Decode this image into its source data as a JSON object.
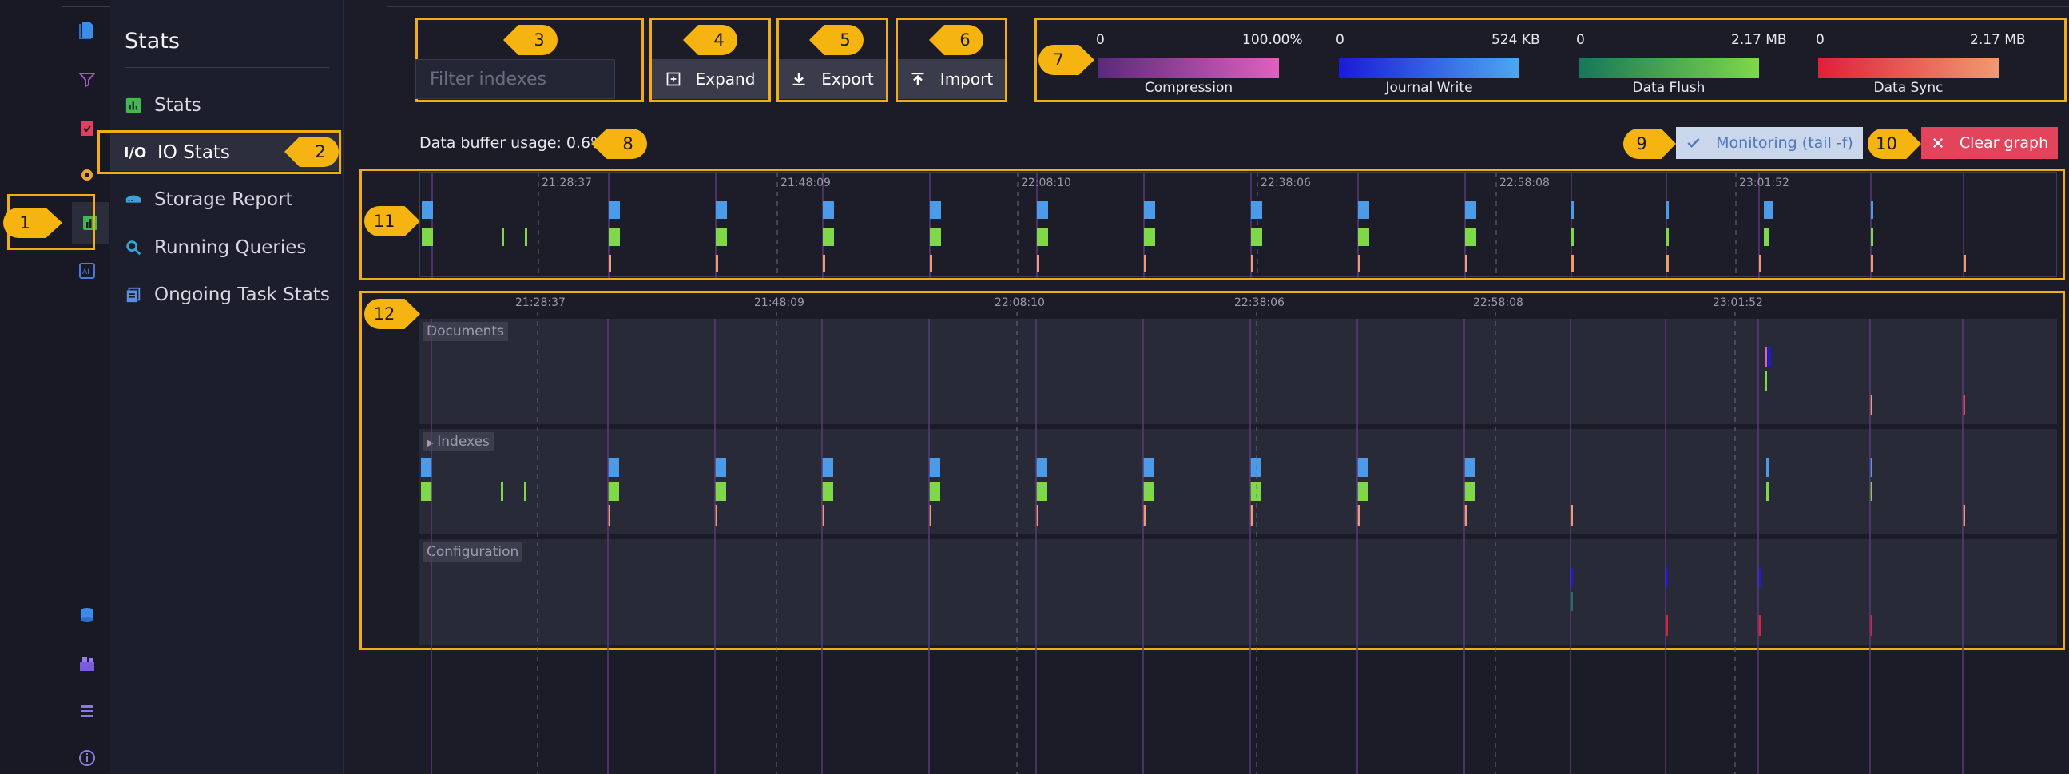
{
  "rail": {
    "icons": [
      "documents-icon",
      "indexes-icon",
      "tasks-icon",
      "settings-icon",
      "stats-icon",
      "ai-icon",
      "databases-icon",
      "cluster-icon",
      "manage-server-icon",
      "about-icon"
    ]
  },
  "menu": {
    "title": "Stats",
    "items": [
      {
        "label": "Stats",
        "icon": "bar-chart-icon",
        "color": "#3fb950"
      },
      {
        "label": "IO Stats",
        "icon": "io-icon",
        "color": "#ffffff"
      },
      {
        "label": "Storage Report",
        "icon": "storage-icon",
        "color": "#38a3d8"
      },
      {
        "label": "Running Queries",
        "icon": "search-icon",
        "color": "#38a3d8"
      },
      {
        "label": "Ongoing Task Stats",
        "icon": "tasks-list-icon",
        "color": "#5a8ee0"
      }
    ]
  },
  "markers": [
    "1",
    "2",
    "3",
    "4",
    "5",
    "6",
    "7",
    "8",
    "9",
    "10",
    "11",
    "12"
  ],
  "toolbar": {
    "filter_placeholder": "Filter indexes",
    "expand_label": "Expand",
    "export_label": "Export",
    "import_label": "Import"
  },
  "legend": [
    {
      "min": "0",
      "max": "100.00%",
      "name": "Compression",
      "color_start": "#5a2a7a",
      "color_end": "#e060c0"
    },
    {
      "min": "0",
      "max": "524 KB",
      "name": "Journal Write",
      "color_start": "#1a1ad8",
      "color_end": "#4ca8f0"
    },
    {
      "min": "0",
      "max": "2.17 MB",
      "name": "Data Flush",
      "color_start": "#16765a",
      "color_end": "#7ed84a"
    },
    {
      "min": "0",
      "max": "2.17 MB",
      "name": "Data Sync",
      "color_start": "#e0203a",
      "color_end": "#f09a70"
    }
  ],
  "buffer_usage": "Data buffer usage: 0.6%",
  "monitoring_label": "Monitoring (tail -f)",
  "clear_label": "Clear graph",
  "timeline": {
    "time_labels": [
      "21:28:37",
      "21:48:09",
      "22:08:10",
      "22:38:06",
      "22:58:08",
      "23:01:52"
    ]
  },
  "sections": [
    {
      "label": "Documents"
    },
    {
      "label": "Indexes"
    },
    {
      "label": "Configuration"
    }
  ]
}
